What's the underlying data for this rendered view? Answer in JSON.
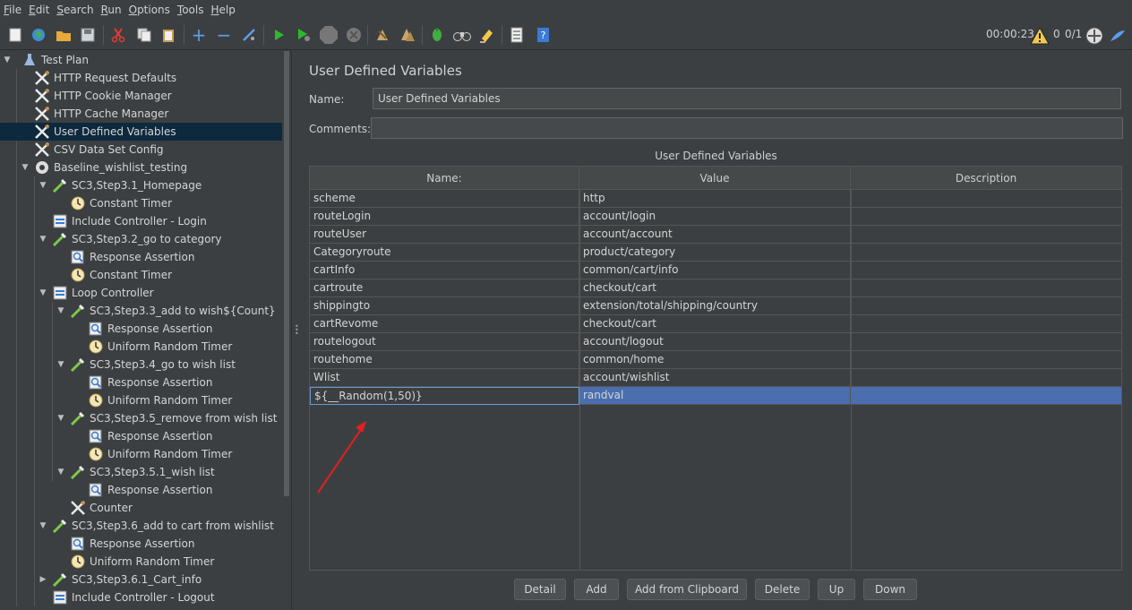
{
  "menu": {
    "items": [
      {
        "label": "File",
        "u": "F",
        "rest": "ile"
      },
      {
        "label": "Edit",
        "u": "E",
        "rest": "dit"
      },
      {
        "label": "Search",
        "u": "S",
        "rest": "earch"
      },
      {
        "label": "Run",
        "u": "R",
        "rest": "un"
      },
      {
        "label": "Options",
        "u": "O",
        "rest": "ptions"
      },
      {
        "label": "Tools",
        "u": "T",
        "rest": "ools"
      },
      {
        "label": "Help",
        "u": "H",
        "rest": "elp"
      }
    ]
  },
  "toolbar": {
    "timer": "00:00:23",
    "warning_count": "0",
    "threads": "0/1"
  },
  "tree": {
    "nodes": [
      {
        "label": "Test Plan",
        "icon": "flask-icon"
      },
      {
        "label": "HTTP Request Defaults",
        "icon": "wrench-icon"
      },
      {
        "label": "HTTP Cookie Manager",
        "icon": "wrench-icon"
      },
      {
        "label": "HTTP Cache Manager",
        "icon": "wrench-icon"
      },
      {
        "label": "User Defined Variables",
        "icon": "wrench-icon"
      },
      {
        "label": "CSV Data Set Config",
        "icon": "wrench-icon"
      },
      {
        "label": "Baseline_wishlist_testing",
        "icon": "gear-icon"
      },
      {
        "label": "SC3,Step3.1_Homepage",
        "icon": "pipette-icon"
      },
      {
        "label": "Constant Timer",
        "icon": "clock-icon"
      },
      {
        "label": "Include Controller - Login",
        "icon": "controller-icon"
      },
      {
        "label": "SC3,Step3.2_go to category",
        "icon": "pipette-icon"
      },
      {
        "label": "Response Assertion",
        "icon": "magnifier-icon"
      },
      {
        "label": "Constant Timer",
        "icon": "clock-icon"
      },
      {
        "label": "Loop Controller",
        "icon": "controller-icon"
      },
      {
        "label": "SC3,Step3.3_add to wish${Count}",
        "icon": "pipette-icon"
      },
      {
        "label": "Response Assertion",
        "icon": "magnifier-icon"
      },
      {
        "label": "Uniform Random Timer",
        "icon": "clock-icon"
      },
      {
        "label": "SC3,Step3.4_go to wish list",
        "icon": "pipette-icon"
      },
      {
        "label": "Response Assertion",
        "icon": "magnifier-icon"
      },
      {
        "label": "Uniform Random Timer",
        "icon": "clock-icon"
      },
      {
        "label": "SC3,Step3.5_remove from wish list",
        "icon": "pipette-icon"
      },
      {
        "label": "Response Assertion",
        "icon": "magnifier-icon"
      },
      {
        "label": "Uniform Random Timer",
        "icon": "clock-icon"
      },
      {
        "label": "SC3,Step3.5.1_wish list",
        "icon": "pipette-icon"
      },
      {
        "label": "Response Assertion",
        "icon": "magnifier-icon"
      },
      {
        "label": "Counter",
        "icon": "wrench-icon"
      },
      {
        "label": "SC3,Step3.6_add to cart from wishlist",
        "icon": "pipette-icon"
      },
      {
        "label": "Response Assertion",
        "icon": "magnifier-icon"
      },
      {
        "label": "Uniform Random Timer",
        "icon": "clock-icon"
      },
      {
        "label": "SC3,Step3.6.1_Cart_info",
        "icon": "pipette-icon"
      },
      {
        "label": "Include Controller - Logout",
        "icon": "controller-icon"
      }
    ]
  },
  "panel": {
    "title": "User Defined Variables",
    "name_label": "Name:",
    "name_value": "User Defined Variables",
    "comments_label": "Comments:",
    "comments_value": "",
    "table_caption": "User Defined Variables",
    "columns": [
      "Name:",
      "Value",
      "Description"
    ],
    "rows": [
      [
        "scheme",
        "http",
        ""
      ],
      [
        "routeLogin",
        "account/login",
        ""
      ],
      [
        "routeUser",
        "account/account",
        ""
      ],
      [
        "Categoryroute",
        "product/category",
        ""
      ],
      [
        "cartInfo",
        "common/cart/info",
        ""
      ],
      [
        "cartroute",
        "checkout/cart",
        ""
      ],
      [
        "shippingto",
        "extension/total/shipping/country",
        ""
      ],
      [
        "cartRevome",
        "checkout/cart",
        ""
      ],
      [
        "routelogout",
        "account/logout",
        ""
      ],
      [
        "routehome",
        "common/home",
        ""
      ],
      [
        "Wlist",
        "account/wishlist",
        ""
      ],
      [
        "${__Random(1,50)}",
        "randval",
        ""
      ]
    ],
    "buttons": [
      "Detail",
      "Add",
      "Add from Clipboard",
      "Delete",
      "Up",
      "Down"
    ]
  },
  "colors": {
    "selection": "#4b6eaf",
    "tree_selection": "#0d293e",
    "annotation_arrow": "#e02020"
  }
}
